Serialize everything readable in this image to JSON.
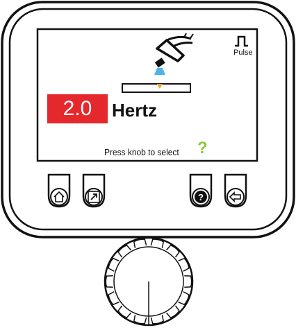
{
  "display": {
    "value": "2.0",
    "unit": "Hertz",
    "mode_label": "Pulse",
    "hint_text": "Press knob to select",
    "hint_mark": "?"
  },
  "progress": {
    "value_fraction": 0.55
  },
  "colors": {
    "value_bg": "#e4282c",
    "hint_mark": "#8cc63f",
    "arc": "#4fb3e8",
    "progress_mark": "#f0a030"
  },
  "buttons": [
    {
      "name": "home-button",
      "icon": "home-icon"
    },
    {
      "name": "shortcut-button",
      "icon": "shortcut-arrow-icon"
    },
    {
      "name": "help-button",
      "icon": "help-icon"
    },
    {
      "name": "back-button",
      "icon": "back-arrow-icon"
    }
  ],
  "knob": {
    "name": "selector-knob"
  }
}
